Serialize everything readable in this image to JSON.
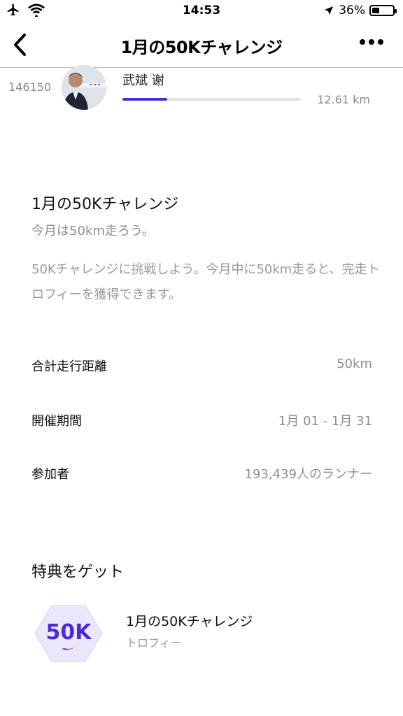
{
  "status_bar": {
    "time": "14:53",
    "battery_text": "36%",
    "battery_level": 0.36,
    "icons": [
      "airplane-icon",
      "wifi-icon",
      "location-arrow-icon",
      "battery-icon"
    ]
  },
  "nav": {
    "title": "1月の50Kチャレンジ",
    "back_icon": "chevron-left-icon",
    "more_icon": "more-horizontal-icon"
  },
  "leaderboard_entry": {
    "rank": "146150",
    "name": "武斌 谢",
    "distance": "12.61 km",
    "progress": 0.25
  },
  "challenge": {
    "title": "1月の50Kチャレンジ",
    "subtitle": "今月は50km走ろう。",
    "description": "50Kチャレンジに挑戦しよう。今月中に50km走ると、完走トロフィーを獲得できます。"
  },
  "details": [
    {
      "label": "合計走行距離",
      "value": "50km"
    },
    {
      "label": "開催期間",
      "value": "1月 01 - 1月 31"
    },
    {
      "label": "参加者",
      "value": "193,439人のランナー"
    }
  ],
  "rewards": {
    "heading": "特典をゲット",
    "items": [
      {
        "badge_text": "50K",
        "title": "1月の50Kチャレンジ",
        "subtitle": "トロフィー"
      }
    ]
  },
  "colors": {
    "accent": "#4B2BD6",
    "badge_bg": "#EDE5FB",
    "muted_text": "#8F8F8F"
  }
}
